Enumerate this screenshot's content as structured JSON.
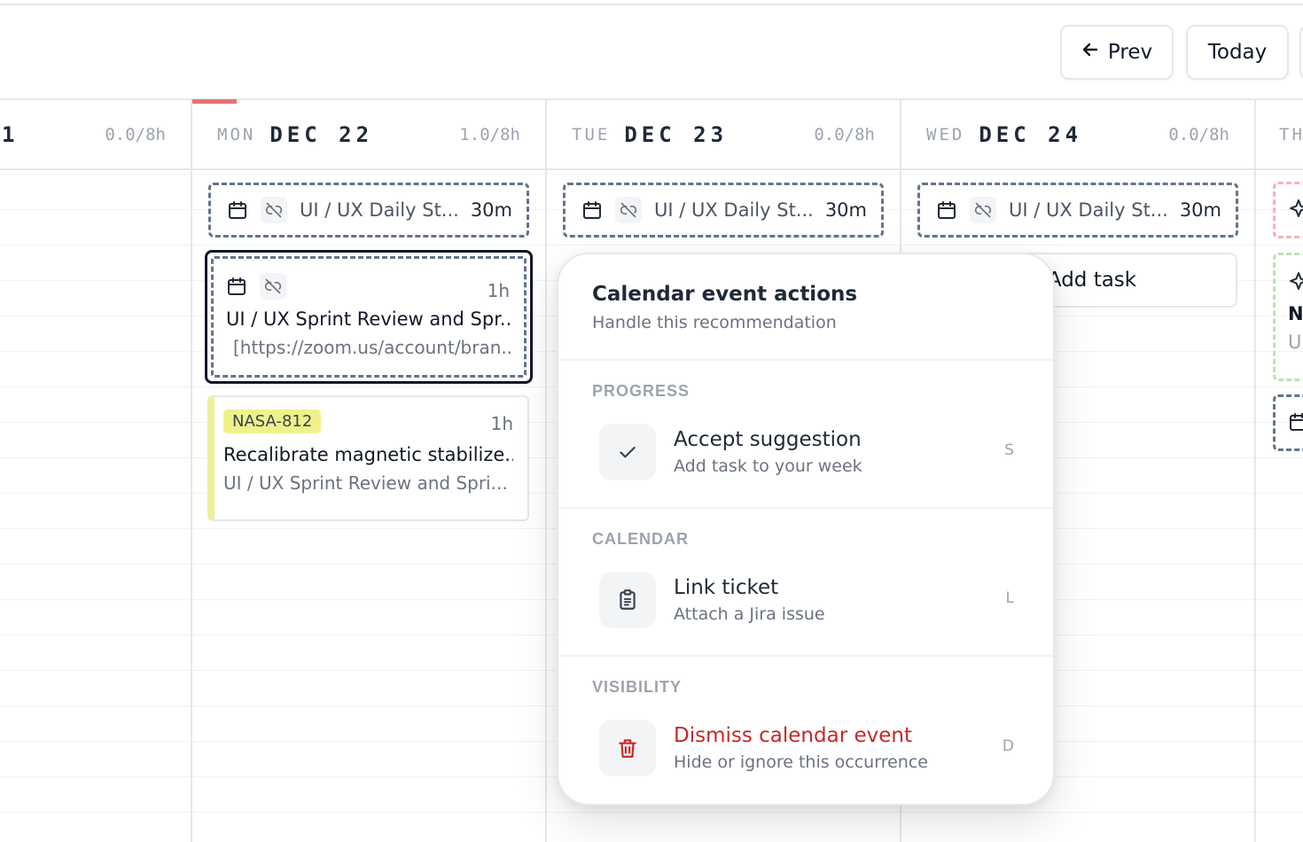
{
  "toolbar": {
    "prev_label": "Prev",
    "today_label": "Today"
  },
  "days": [
    {
      "dow": "",
      "date": "1",
      "hours": "0.0/8h"
    },
    {
      "dow": "MON",
      "date": "DEC 22",
      "hours": "1.0/8h"
    },
    {
      "dow": "TUE",
      "date": "DEC 23",
      "hours": "0.0/8h"
    },
    {
      "dow": "WED",
      "date": "DEC 24",
      "hours": "0.0/8h"
    },
    {
      "dow": "TH",
      "date": "",
      "hours": ""
    }
  ],
  "events": {
    "standup_title": "UI / UX Daily St...",
    "standup_duration": "30m",
    "selected_title": "UI / UX Sprint Review and Spr...",
    "selected_subtitle": "[https://zoom.us/account/bran..",
    "selected_duration": "1h"
  },
  "task": {
    "ticket": "NASA-812",
    "duration": "1h",
    "title": "Recalibrate magnetic stabilize...",
    "subtitle": "UI / UX Sprint Review and Spri..."
  },
  "add_task_label": "Add task",
  "thursday": {
    "title_partial": "N",
    "subtitle_partial": "U"
  },
  "popover": {
    "title": "Calendar event actions",
    "subtitle": "Handle this recommendation",
    "sections": [
      {
        "label": "PROGRESS",
        "action_title": "Accept suggestion",
        "action_desc": "Add task to your week",
        "shortcut": "S",
        "icon": "check-icon"
      },
      {
        "label": "CALENDAR",
        "action_title": "Link ticket",
        "action_desc": "Attach a Jira issue",
        "shortcut": "L",
        "icon": "clipboard-icon"
      },
      {
        "label": "VISIBILITY",
        "action_title": "Dismiss calendar event",
        "action_desc": "Hide or ignore this occurrence",
        "shortcut": "D",
        "icon": "trash-icon"
      }
    ]
  },
  "colors": {
    "today_indicator": "#e57373",
    "danger": "#c62828",
    "ticket_badge": "#eff28a",
    "task_accent": "#ecef9c"
  }
}
